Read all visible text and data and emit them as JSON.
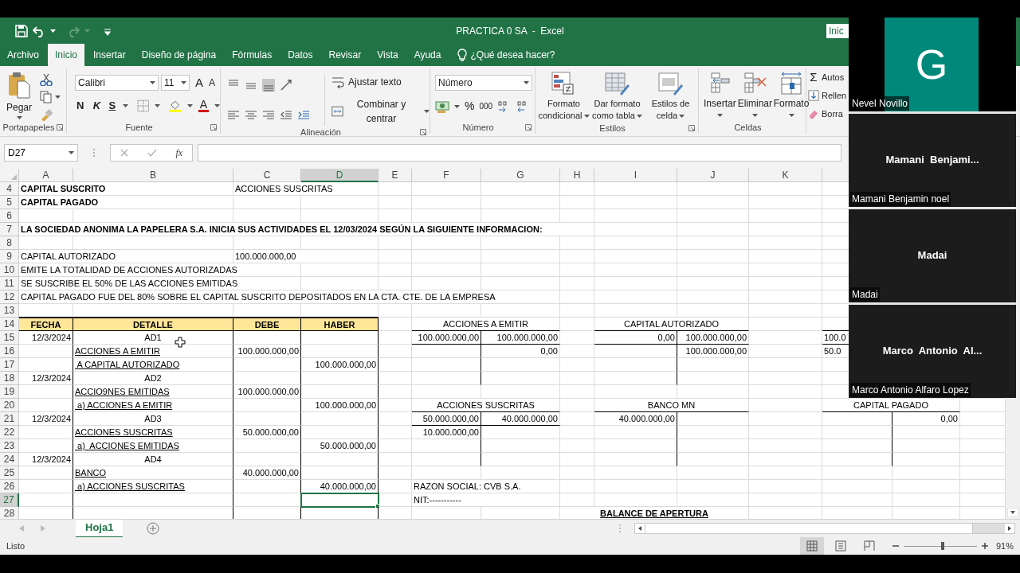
{
  "window": {
    "title": "PRACTICA 0 SA  -  Excel",
    "header_button": "Inic"
  },
  "quick_access": [
    {
      "kind": "save",
      "disabled": false
    },
    {
      "kind": "undo",
      "disabled": false
    },
    {
      "kind": "redo",
      "disabled": true
    },
    {
      "kind": "customize",
      "disabled": false
    }
  ],
  "tabs": [
    {
      "label": "Archivo",
      "selected": false
    },
    {
      "label": "Inicio",
      "selected": true
    },
    {
      "label": "Insertar",
      "selected": false
    },
    {
      "label": "Diseño de página",
      "selected": false
    },
    {
      "label": "Fórmulas",
      "selected": false
    },
    {
      "label": "Datos",
      "selected": false
    },
    {
      "label": "Revisar",
      "selected": false
    },
    {
      "label": "Vista",
      "selected": false
    },
    {
      "label": "Ayuda",
      "selected": false
    }
  ],
  "tell_me": "¿Qué desea hacer?",
  "ribbon": {
    "clipboard": {
      "paste": "Pegar",
      "label": "Portapapeles"
    },
    "font": {
      "family": "Calibri",
      "size": "11",
      "grow": "A",
      "shrink": "A",
      "bold": "N",
      "italic": "K",
      "underline": "S",
      "font_letter": "A",
      "label": "Fuente"
    },
    "alignment": {
      "wrap": "Ajustar texto",
      "merge": "Combinar y centrar",
      "label": "Alineación"
    },
    "number": {
      "format": "Número",
      "percent": "%",
      "thousands": "000",
      "label": "Número"
    },
    "styles": {
      "buttons": [
        {
          "kind": "conditional",
          "lines": [
            "Formato",
            "condicional"
          ]
        },
        {
          "kind": "table",
          "lines": [
            "Dar formato",
            "como tabla"
          ]
        },
        {
          "kind": "cell",
          "lines": [
            "Estilos de",
            "celda"
          ]
        }
      ],
      "label": "Estilos"
    },
    "cells": {
      "buttons": [
        {
          "kind": "insert",
          "label": "Insertar"
        },
        {
          "kind": "delete",
          "label": "Eliminar"
        },
        {
          "kind": "format",
          "label": "Formato"
        }
      ],
      "label": "Celdas"
    },
    "editing": [
      {
        "kind": "sum",
        "symbol": "Σ",
        "label": "Autos"
      },
      {
        "kind": "fill",
        "label": "Rellen"
      },
      {
        "kind": "clear",
        "label": "Borra"
      }
    ]
  },
  "formula_bar": {
    "name_box": "D27",
    "function_symbol": "fx"
  },
  "sheet": {
    "columns": [
      {
        "label": "A",
        "selected": false
      },
      {
        "label": "B",
        "selected": false
      },
      {
        "label": "C",
        "selected": false
      },
      {
        "label": "D",
        "selected": true
      },
      {
        "label": "E",
        "selected": false
      },
      {
        "label": "F",
        "selected": false
      },
      {
        "label": "G",
        "selected": false
      },
      {
        "label": "H",
        "selected": false
      },
      {
        "label": "I",
        "selected": false
      },
      {
        "label": "J",
        "selected": false
      },
      {
        "label": "K",
        "selected": false
      }
    ],
    "rows": [
      {
        "label": "4",
        "selected": false,
        "cells": [
          {
            "text": "CAPITAL SUSCRITO",
            "kind": "bold"
          },
          {
            "text": ""
          },
          {
            "text": "ACCIONES SUSCRITAS",
            "kind": "text"
          }
        ]
      },
      {
        "label": "5",
        "selected": false,
        "cells": [
          {
            "text": "CAPITAL PAGADO",
            "kind": "bold"
          }
        ]
      },
      {
        "label": "6",
        "selected": false,
        "cells": []
      },
      {
        "label": "7",
        "selected": false,
        "cells": [
          {
            "text": "LA SOCIEDAD ANONIMA LA PAPELERA S.A. INICIA SUS ACTIVIDADES EL 12/03/2024 SEGÚN LA SIGUIENTE INFORMACION:",
            "kind": "bold"
          }
        ]
      },
      {
        "label": "8",
        "selected": false,
        "cells": []
      },
      {
        "label": "9",
        "selected": false,
        "cells": [
          {
            "text": "CAPITAL AUTORIZADO",
            "kind": "text"
          },
          {
            "text": ""
          },
          {
            "text": "100.000.000,00",
            "kind": "text"
          }
        ]
      },
      {
        "label": "10",
        "selected": false,
        "cells": [
          {
            "text": "EMITE LA TOTALIDAD DE ACCIONES AUTORIZADAS",
            "kind": "text"
          }
        ]
      },
      {
        "label": "11",
        "selected": false,
        "cells": [
          {
            "text": "SE SUSCRIBE EL 50% DE LAS ACCIONES EMITIDAS",
            "kind": "text"
          }
        ]
      },
      {
        "label": "12",
        "selected": false,
        "cells": [
          {
            "text": "CAPITAL PAGADO FUE DEL 80% SOBRE EL CAPITAL SUSCRITO DEPOSITADOS EN LA CTA. CTE. DE LA EMPRESA",
            "kind": "text"
          }
        ]
      },
      {
        "label": "13",
        "selected": false,
        "cells": []
      },
      {
        "label": "14",
        "selected": false,
        "cells": [
          {
            "text": "FECHA",
            "kind": "header"
          },
          {
            "text": "DETALLE",
            "kind": "header"
          },
          {
            "text": "DEBE",
            "kind": "header"
          },
          {
            "text": "HABER",
            "kind": "header"
          },
          {
            "text": ""
          },
          {
            "text": "ACCIONES A EMITIR",
            "kind": "centered",
            "colspan": 2
          },
          {
            "text": ""
          },
          {
            "text": "CAPITAL AUTORIZADO",
            "kind": "centered",
            "colspan": 2
          }
        ]
      },
      {
        "label": "15",
        "selected": false,
        "cells": [
          {
            "text": "12/3/2024",
            "kind": "number"
          },
          {
            "text": "AD1",
            "kind": "centered"
          },
          {
            "text": ""
          },
          {
            "text": ""
          },
          {
            "text": ""
          },
          {
            "text": "100.000.000,00",
            "kind": "number"
          },
          {
            "text": "100.000.000,00",
            "kind": "number"
          },
          {
            "text": ""
          },
          {
            "text": "0,00",
            "kind": "number"
          },
          {
            "text": "100.000.000,00",
            "kind": "number"
          },
          {
            "text": ""
          },
          {
            "text": "100.0",
            "kind": "text"
          }
        ]
      },
      {
        "label": "16",
        "selected": false,
        "cells": [
          {
            "text": ""
          },
          {
            "text": "ACCIONES A EMITIR",
            "kind": "underline"
          },
          {
            "text": "100.000.000,00",
            "kind": "number"
          },
          {
            "text": ""
          },
          {
            "text": ""
          },
          {
            "text": ""
          },
          {
            "text": "0,00",
            "kind": "number"
          },
          {
            "text": ""
          },
          {
            "text": ""
          },
          {
            "text": "100.000.000,00",
            "kind": "number"
          },
          {
            "text": ""
          },
          {
            "text": "50.0",
            "kind": "text"
          }
        ]
      },
      {
        "label": "17",
        "selected": false,
        "cells": [
          {
            "text": ""
          },
          {
            "text": " A CAPITAL AUTORIZADO",
            "kind": "underline"
          },
          {
            "text": ""
          },
          {
            "text": "100.000.000,00",
            "kind": "number"
          }
        ]
      },
      {
        "label": "18",
        "selected": false,
        "cells": [
          {
            "text": "12/3/2024",
            "kind": "number"
          },
          {
            "text": "AD2",
            "kind": "centered"
          }
        ]
      },
      {
        "label": "19",
        "selected": false,
        "cells": [
          {
            "text": ""
          },
          {
            "text": "ACCIO9NES EMITIDAS",
            "kind": "underline"
          },
          {
            "text": "100.000.000,00",
            "kind": "number"
          }
        ]
      },
      {
        "label": "20",
        "selected": false,
        "cells": [
          {
            "text": ""
          },
          {
            "text": " a) ACCIONES A EMITIR",
            "kind": "underline"
          },
          {
            "text": ""
          },
          {
            "text": "100.000.000,00",
            "kind": "number"
          },
          {
            "text": ""
          },
          {
            "text": "ACCIONES SUSCRITAS",
            "kind": "centered",
            "colspan": 2
          },
          {
            "text": ""
          },
          {
            "text": "BANCO MN",
            "kind": "centered",
            "colspan": 2
          },
          {
            "text": ""
          },
          {
            "text": "CAPITAL PAGADO",
            "kind": "centered",
            "colspan": 2
          }
        ]
      },
      {
        "label": "21",
        "selected": false,
        "cells": [
          {
            "text": "12/3/2024",
            "kind": "number"
          },
          {
            "text": "AD3",
            "kind": "centered"
          },
          {
            "text": ""
          },
          {
            "text": ""
          },
          {
            "text": ""
          },
          {
            "text": "50.000.000,00",
            "kind": "number"
          },
          {
            "text": "40.000.000,00",
            "kind": "number"
          },
          {
            "text": ""
          },
          {
            "text": "40.000.000,00",
            "kind": "number"
          },
          {
            "text": ""
          },
          {
            "text": ""
          },
          {
            "text": ""
          },
          {
            "text": "0,00",
            "kind": "number"
          }
        ]
      },
      {
        "label": "22",
        "selected": false,
        "cells": [
          {
            "text": ""
          },
          {
            "text": "ACCIONES SUSCRITAS",
            "kind": "underline"
          },
          {
            "text": "50.000.000,00",
            "kind": "number"
          },
          {
            "text": ""
          },
          {
            "text": ""
          },
          {
            "text": "10.000.000,00",
            "kind": "number"
          }
        ]
      },
      {
        "label": "23",
        "selected": false,
        "cells": [
          {
            "text": ""
          },
          {
            "text": " a)  ACCIONES EMITIDAS",
            "kind": "underline"
          },
          {
            "text": ""
          },
          {
            "text": "50.000.000,00",
            "kind": "number"
          }
        ]
      },
      {
        "label": "24",
        "selected": false,
        "cells": [
          {
            "text": "12/3/2024",
            "kind": "number"
          },
          {
            "text": "AD4",
            "kind": "centered"
          }
        ]
      },
      {
        "label": "25",
        "selected": false,
        "cells": [
          {
            "text": ""
          },
          {
            "text": "BANCO",
            "kind": "underline"
          },
          {
            "text": "40.000.000,00",
            "kind": "number"
          }
        ]
      },
      {
        "label": "26",
        "selected": false,
        "cells": [
          {
            "text": ""
          },
          {
            "text": " a) ACCIONES SUSCRITAS",
            "kind": "underline"
          },
          {
            "text": ""
          },
          {
            "text": "40.000.000,00",
            "kind": "number"
          },
          {
            "text": ""
          },
          {
            "text": "RAZON SOCIAL: CVB S.A.",
            "kind": "text"
          }
        ]
      },
      {
        "label": "27",
        "selected": true,
        "cells": [
          {
            "text": ""
          },
          {
            "text": ""
          },
          {
            "text": ""
          },
          {
            "text": ""
          },
          {
            "text": ""
          },
          {
            "text": "NIT:-----------",
            "kind": "text"
          }
        ]
      },
      {
        "label": "28",
        "selected": false,
        "cells": [
          {
            "text": ""
          },
          {
            "text": ""
          },
          {
            "text": ""
          },
          {
            "text": ""
          },
          {
            "text": ""
          },
          {
            "text": ""
          },
          {
            "text": ""
          },
          {
            "text": "BALANCE DE APERTURA",
            "kind": "title",
            "colspan": 3
          }
        ]
      }
    ]
  },
  "sheet_tabs": [
    {
      "label": "Hoja1",
      "selected": true
    }
  ],
  "status_bar": {
    "status": "Listo",
    "views": [
      {
        "kind": "normal",
        "selected": true
      },
      {
        "kind": "page_layout",
        "selected": false
      },
      {
        "kind": "page_break",
        "selected": false
      }
    ],
    "zoom_slider": {
      "level": 0.53
    },
    "zoom": "91%"
  },
  "participants": [
    {
      "kind": "avatar",
      "initial": "G",
      "name": "Nevel Novillo"
    },
    {
      "kind": "name",
      "display": "Mamani  Benjami...",
      "name": "Mamani Benjamin noel"
    },
    {
      "kind": "name",
      "display": "Madai",
      "name": "Madai"
    },
    {
      "kind": "name",
      "display": "Marco  Antonio  Al...",
      "name": "Marco Antonio Alfaro Lopez"
    }
  ]
}
